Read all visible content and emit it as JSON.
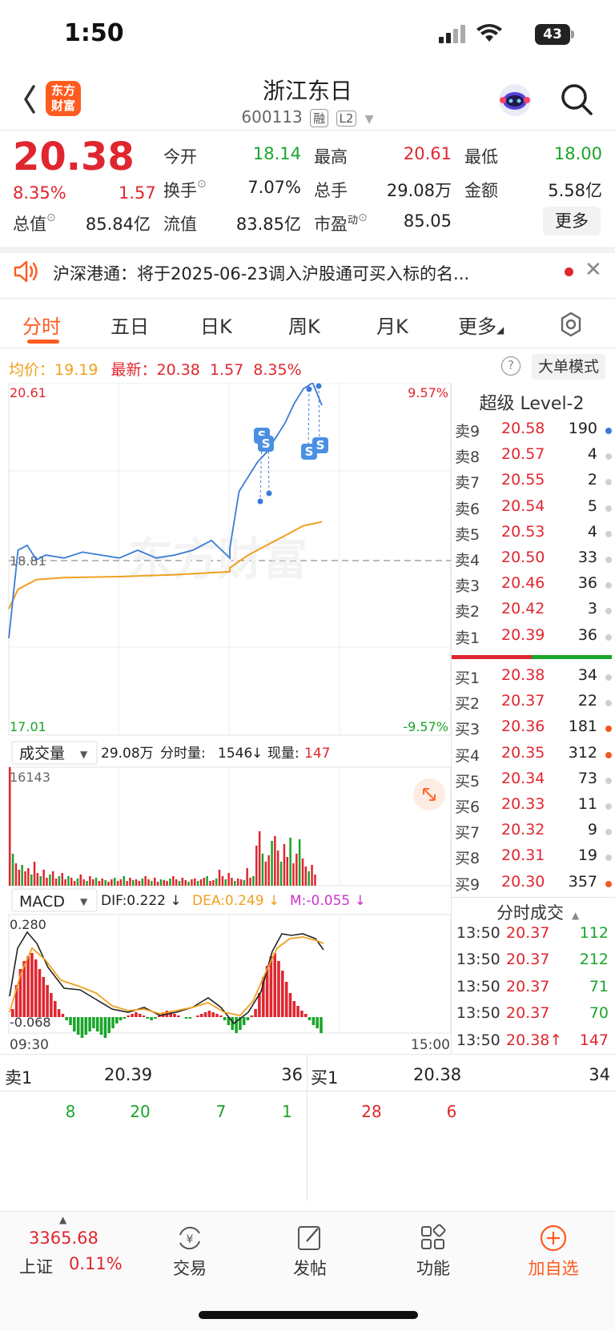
{
  "status_bar": {
    "time": "1:50",
    "battery": "43"
  },
  "header": {
    "logo_line1": "东方",
    "logo_line2": "财富",
    "stock_name": "浙江东日",
    "stock_code": "600113",
    "tag_rong": "融",
    "tag_l2": "L2"
  },
  "quote": {
    "price": "20.38",
    "change_pct": "8.35%",
    "change_amt": "1.57",
    "open_label": "今开",
    "open": "18.14",
    "high_label": "最高",
    "high": "20.61",
    "low_label": "最低",
    "low": "18.00",
    "turnover_label": "换手",
    "turnover": "7.07%",
    "volume_label": "总手",
    "volume": "29.08万",
    "amount_label": "金额",
    "amount": "5.58亿",
    "mktcap_label": "总值",
    "mktcap": "85.84亿",
    "float_label": "流值",
    "float_cap": "83.85亿",
    "pe_label": "市盈",
    "pe_sup": "动",
    "pe": "85.05",
    "more_label": "更多"
  },
  "notice": {
    "text": "沪深港通：将于2025-06-23调入沪股通可买入标的名..."
  },
  "tabs": [
    "分时",
    "五日",
    "日K",
    "周K",
    "月K",
    "更多"
  ],
  "info_line": {
    "avg_label": "均价：",
    "avg": "19.19",
    "latest_label": "最新：",
    "latest": "20.38",
    "chg": "1.57",
    "pct": "8.35%",
    "help": "?",
    "big_order_label": "大单模式"
  },
  "chart_labels": {
    "top_price": "20.61",
    "top_pct": "9.57%",
    "mid_price": "18.81",
    "bottom_price": "17.01",
    "bottom_pct": "-9.57%",
    "vol_selector": "成交量",
    "vol_total": "29.08万",
    "vol_min_label": "分时量:",
    "vol_min": "1546",
    "vol_now_label": "现量:",
    "vol_now": "147",
    "vol_max": "16143",
    "macd_selector": "MACD",
    "dif": "DIF:0.222 ↓",
    "dea": "DEA:0.249 ↓",
    "m": "M:-0.055 ↓",
    "macd_top": "0.280",
    "macd_bottom": "-0.068",
    "time_start": "09:30",
    "time_end": "15:00",
    "markers": [
      "S",
      "S",
      "S",
      "S"
    ]
  },
  "chart_data": {
    "type": "line",
    "title": "",
    "series": [
      {
        "name": "price",
        "x": [
          "09:30",
          "09:35",
          "09:40",
          "09:45",
          "09:50",
          "10:00",
          "10:10",
          "10:20",
          "10:30",
          "10:40",
          "10:50",
          "11:00",
          "11:10",
          "11:20",
          "11:30",
          "13:00",
          "13:05",
          "13:10",
          "13:15",
          "13:20",
          "13:25",
          "13:30",
          "13:35",
          "13:40",
          "13:45",
          "13:50"
        ],
        "values": [
          18.0,
          18.9,
          18.95,
          18.8,
          18.85,
          18.82,
          18.88,
          18.85,
          18.82,
          18.9,
          18.82,
          18.85,
          18.9,
          19.0,
          18.82,
          18.92,
          19.5,
          19.65,
          19.8,
          19.9,
          20.05,
          20.2,
          20.4,
          20.55,
          20.61,
          20.38
        ]
      },
      {
        "name": "average",
        "x": [
          "09:30",
          "09:35",
          "09:45",
          "10:00",
          "10:30",
          "11:00",
          "11:30",
          "13:00",
          "13:10",
          "13:20",
          "13:30",
          "13:40",
          "13:50"
        ],
        "values": [
          18.3,
          18.5,
          18.6,
          18.62,
          18.63,
          18.65,
          18.68,
          18.72,
          18.85,
          18.95,
          19.05,
          19.15,
          19.19
        ]
      }
    ],
    "ylim": [
      17.01,
      20.61
    ],
    "reference": 18.81
  },
  "level2": {
    "title": "超级 Level-2",
    "asks": [
      {
        "label": "卖9",
        "price": "20.58",
        "vol": "190",
        "dot": "#3a7bd5"
      },
      {
        "label": "卖8",
        "price": "20.57",
        "vol": "4",
        "dot": "#d0d0d0"
      },
      {
        "label": "卖7",
        "price": "20.55",
        "vol": "2",
        "dot": "#d0d0d0"
      },
      {
        "label": "卖6",
        "price": "20.54",
        "vol": "5",
        "dot": "#d0d0d0"
      },
      {
        "label": "卖5",
        "price": "20.53",
        "vol": "4",
        "dot": "#d0d0d0"
      },
      {
        "label": "卖4",
        "price": "20.50",
        "vol": "33",
        "dot": "#d0d0d0"
      },
      {
        "label": "卖3",
        "price": "20.46",
        "vol": "36",
        "dot": "#d0d0d0"
      },
      {
        "label": "卖2",
        "price": "20.42",
        "vol": "3",
        "dot": "#d0d0d0"
      },
      {
        "label": "卖1",
        "price": "20.39",
        "vol": "36",
        "dot": "#d0d0d0"
      }
    ],
    "bids": [
      {
        "label": "买1",
        "price": "20.38",
        "vol": "34",
        "dot": "#d0d0d0"
      },
      {
        "label": "买2",
        "price": "20.37",
        "vol": "22",
        "dot": "#d0d0d0"
      },
      {
        "label": "买3",
        "price": "20.36",
        "vol": "181",
        "dot": "#f05a20"
      },
      {
        "label": "买4",
        "price": "20.35",
        "vol": "312",
        "dot": "#f05a20"
      },
      {
        "label": "买5",
        "price": "20.34",
        "vol": "73",
        "dot": "#d0d0d0"
      },
      {
        "label": "买6",
        "price": "20.33",
        "vol": "11",
        "dot": "#d0d0d0"
      },
      {
        "label": "买7",
        "price": "20.32",
        "vol": "9",
        "dot": "#d0d0d0"
      },
      {
        "label": "买8",
        "price": "20.31",
        "vol": "19",
        "dot": "#d0d0d0"
      },
      {
        "label": "买9",
        "price": "20.30",
        "vol": "357",
        "dot": "#f05a20"
      }
    ]
  },
  "ticks": {
    "title": "分时成交",
    "rows": [
      {
        "time": "13:50",
        "price": "20.37",
        "vol": "112",
        "color": "#1aa52a"
      },
      {
        "time": "13:50",
        "price": "20.37",
        "vol": "212",
        "color": "#1aa52a"
      },
      {
        "time": "13:50",
        "price": "20.37",
        "vol": "71",
        "color": "#1aa52a"
      },
      {
        "time": "13:50",
        "price": "20.37",
        "vol": "70",
        "color": "#1aa52a"
      },
      {
        "time": "13:50",
        "price": "20.38↑",
        "vol": "147",
        "color": "#e0262f"
      }
    ]
  },
  "queue": {
    "sell_label": "卖1",
    "sell_price": "20.39",
    "sell_vol": "36",
    "buy_label": "买1",
    "buy_price": "20.38",
    "buy_vol": "34",
    "sell_orders": [
      "8",
      "20",
      "7",
      "1"
    ],
    "buy_orders": [
      "28",
      "6"
    ]
  },
  "bottom_nav": {
    "index_value": "3365.68",
    "index_name": "上证",
    "index_pct": "0.11%",
    "trade": "交易",
    "post": "发帖",
    "function": "功能",
    "add_watch": "加自选"
  },
  "colors": {
    "up": "#e0262f",
    "down": "#1aa52a",
    "accent": "#ff5a1f",
    "avg": "#f0a020",
    "price_line": "#3a7bd5"
  }
}
